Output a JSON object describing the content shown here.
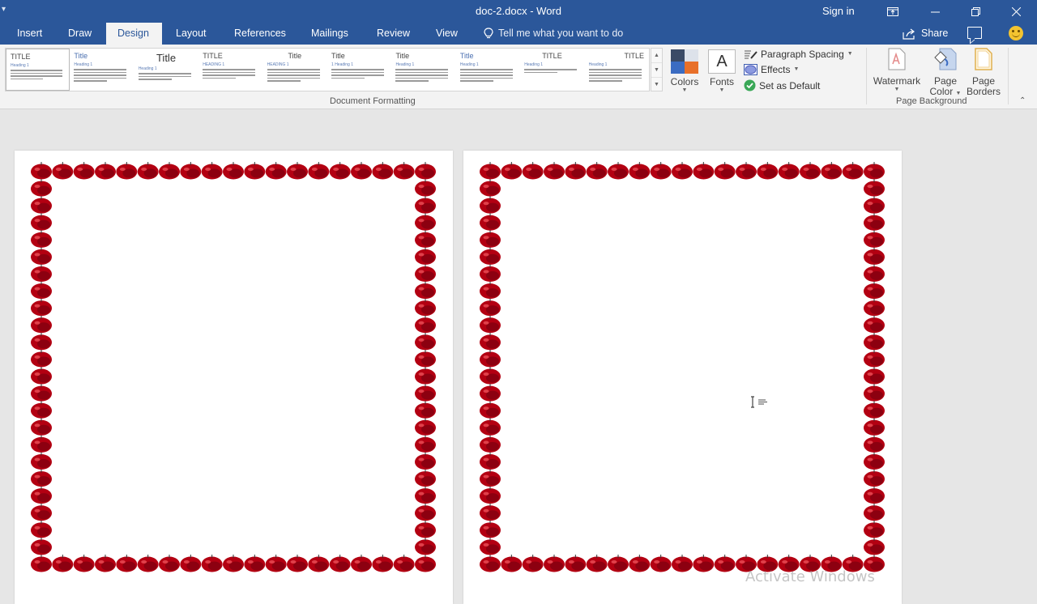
{
  "titlebar": {
    "title": "doc-2.docx  -  Word",
    "sign_in": "Sign in",
    "buttons": [
      "ribbon-display-options",
      "minimize",
      "restore",
      "close"
    ]
  },
  "tabs": [
    {
      "label": "Insert",
      "active": false
    },
    {
      "label": "Draw",
      "active": false
    },
    {
      "label": "Design",
      "active": true
    },
    {
      "label": "Layout",
      "active": false
    },
    {
      "label": "References",
      "active": false
    },
    {
      "label": "Mailings",
      "active": false
    },
    {
      "label": "Review",
      "active": false
    },
    {
      "label": "View",
      "active": false
    }
  ],
  "tell_me": {
    "placeholder": "Tell me what you want to do",
    "icon": "lightbulb-icon"
  },
  "share": {
    "label": "Share",
    "icon": "share-icon"
  },
  "ribbon": {
    "document_formatting": {
      "group_label": "Document Formatting",
      "styles": [
        {
          "title": "TITLE",
          "heading": "Heading 1"
        },
        {
          "title": "Title",
          "heading": "Heading 1"
        },
        {
          "title": "Title",
          "heading": "Heading 1"
        },
        {
          "title": "TITLE",
          "heading": "HEADING 1"
        },
        {
          "title": "Title",
          "heading": "HEADING 1"
        },
        {
          "title": "Title",
          "heading": "1  Heading 1"
        },
        {
          "title": "Title",
          "heading": "Heading 1"
        },
        {
          "title": "Title",
          "heading": "Heading 1"
        },
        {
          "title": "TITLE",
          "heading": "Heading 1"
        },
        {
          "title": "TITLE",
          "heading": "Heading 1"
        }
      ],
      "colors_label": "Colors",
      "fonts_label": "Fonts",
      "fonts_glyph": "A",
      "paragraph_spacing": "Paragraph Spacing",
      "effects": "Effects",
      "set_as_default": "Set as Default",
      "colors_swatch": [
        "#3a4a66",
        "#dde2ea",
        "#3b6cc2",
        "#e8702a"
      ]
    },
    "page_background": {
      "group_label": "Page Background",
      "watermark": "Watermark",
      "page_color": [
        "Page",
        "Color"
      ],
      "page_borders": [
        "Page",
        "Borders"
      ]
    }
  },
  "document": {
    "pages": 2,
    "border_art": "apples",
    "border_color": "#b00010"
  },
  "watermark_text": "Activate Windows"
}
